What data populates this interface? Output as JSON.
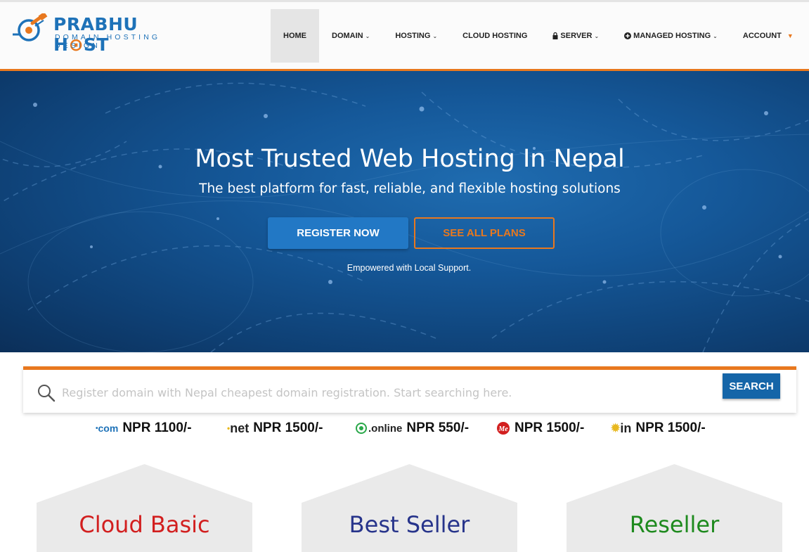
{
  "brand": {
    "name_part1": "PRABHU H",
    "name_part2": "ST",
    "tagline": "DOMAIN HOSTING DESIGN"
  },
  "nav": {
    "items": [
      {
        "label": "HOME",
        "active": true
      },
      {
        "label": "DOMAIN",
        "dropdown": true
      },
      {
        "label": "HOSTING",
        "dropdown": true
      },
      {
        "label": "CLOUD HOSTING"
      },
      {
        "label": "SERVER",
        "dropdown": true,
        "icon": "lock-icon"
      },
      {
        "label": "MANAGED HOSTING",
        "dropdown": true,
        "icon": "plus-circle-icon"
      },
      {
        "label": "ACCOUNT",
        "dropdown": true
      }
    ]
  },
  "hero": {
    "title": "Most Trusted Web Hosting In Nepal",
    "subtitle": "The best platform for fast, reliable, and flexible hosting solutions",
    "register_label": "REGISTER NOW",
    "plans_label": "SEE ALL PLANS",
    "note": "Empowered with Local Support."
  },
  "search": {
    "placeholder": "Register domain with Nepal cheapest domain registration. Start searching here.",
    "button_label": "SEARCH"
  },
  "tlds": [
    {
      "name": ".com",
      "price": "NPR 1100/-",
      "icon": "com-logo-icon"
    },
    {
      "name": ".net",
      "price": "NPR 1500/-",
      "icon": "net-logo-icon"
    },
    {
      "name": ".online",
      "price": "NPR 550/-",
      "icon": "online-logo-icon"
    },
    {
      "name": "Me",
      "price": "NPR 1500/-",
      "icon": "me-logo-icon"
    },
    {
      "name": ".in",
      "price": "NPR 1500/-",
      "icon": "in-logo-icon"
    }
  ],
  "plans": [
    {
      "title": "Cloud Basic",
      "color": "#d21f1f"
    },
    {
      "title": "Best Seller",
      "color": "#27348b"
    },
    {
      "title": "Reseller",
      "color": "#1e8a1e"
    }
  ],
  "colors": {
    "accent_orange": "#e8781e",
    "primary_blue": "#2278c5",
    "search_blue": "#1565a8"
  }
}
